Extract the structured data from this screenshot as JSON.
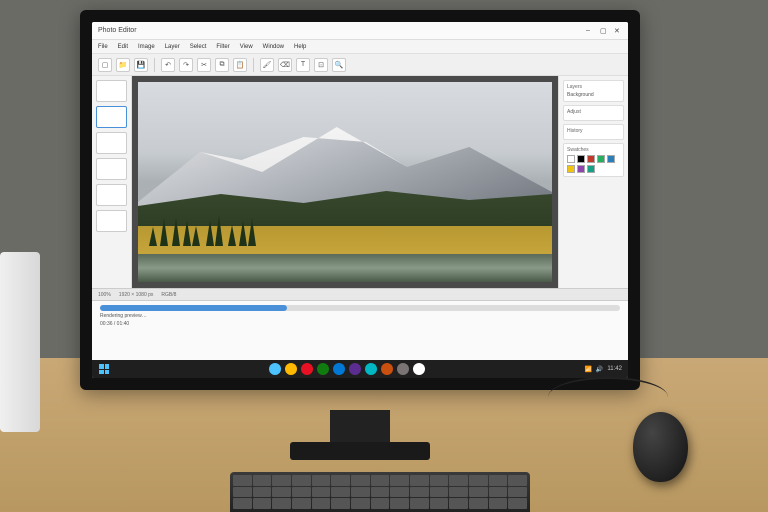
{
  "app": {
    "title": "Photo Editor"
  },
  "menu": {
    "items": [
      "File",
      "Edit",
      "Image",
      "Layer",
      "Select",
      "Filter",
      "View",
      "Window",
      "Help"
    ]
  },
  "toolbar": {
    "buttons": [
      {
        "name": "new-icon",
        "glyph": "▢"
      },
      {
        "name": "open-icon",
        "glyph": "📁"
      },
      {
        "name": "save-icon",
        "glyph": "💾"
      },
      {
        "name": "undo-icon",
        "glyph": "↶"
      },
      {
        "name": "redo-icon",
        "glyph": "↷"
      },
      {
        "name": "cut-icon",
        "glyph": "✂"
      },
      {
        "name": "copy-icon",
        "glyph": "⧉"
      },
      {
        "name": "paste-icon",
        "glyph": "📋"
      },
      {
        "name": "brush-icon",
        "glyph": "🖌"
      },
      {
        "name": "eraser-icon",
        "glyph": "⌫"
      },
      {
        "name": "text-icon",
        "glyph": "T"
      },
      {
        "name": "crop-icon",
        "glyph": "⊡"
      },
      {
        "name": "zoom-icon",
        "glyph": "🔍"
      }
    ]
  },
  "left_panel": {
    "thumbs": [
      {
        "active": false
      },
      {
        "active": true
      },
      {
        "active": false
      },
      {
        "active": false
      },
      {
        "active": false
      },
      {
        "active": false
      }
    ]
  },
  "right_panel": {
    "layers": {
      "title": "Layers",
      "items": [
        "Background"
      ]
    },
    "adjust": {
      "title": "Adjust"
    },
    "history": {
      "title": "History"
    },
    "swatches": {
      "title": "Swatches",
      "colors": [
        "#ffffff",
        "#000000",
        "#c0392b",
        "#27ae60",
        "#2980b9",
        "#f1c40f",
        "#8e44ad",
        "#16a085"
      ]
    }
  },
  "status": {
    "zoom": "100%",
    "dimensions": "1920 × 1080 px",
    "color_mode": "RGB/8"
  },
  "lower": {
    "line1": "Rendering preview…",
    "line2": "00:36 / 01:40",
    "progress_pct": 36
  },
  "taskbar": {
    "pinned_colors": [
      "#4cc2ff",
      "#ffb900",
      "#e81123",
      "#107c10",
      "#0078d4",
      "#5c2d91",
      "#00b7c3",
      "#ca5010",
      "#7a7574",
      "#ffffff"
    ],
    "time": "11:42"
  }
}
